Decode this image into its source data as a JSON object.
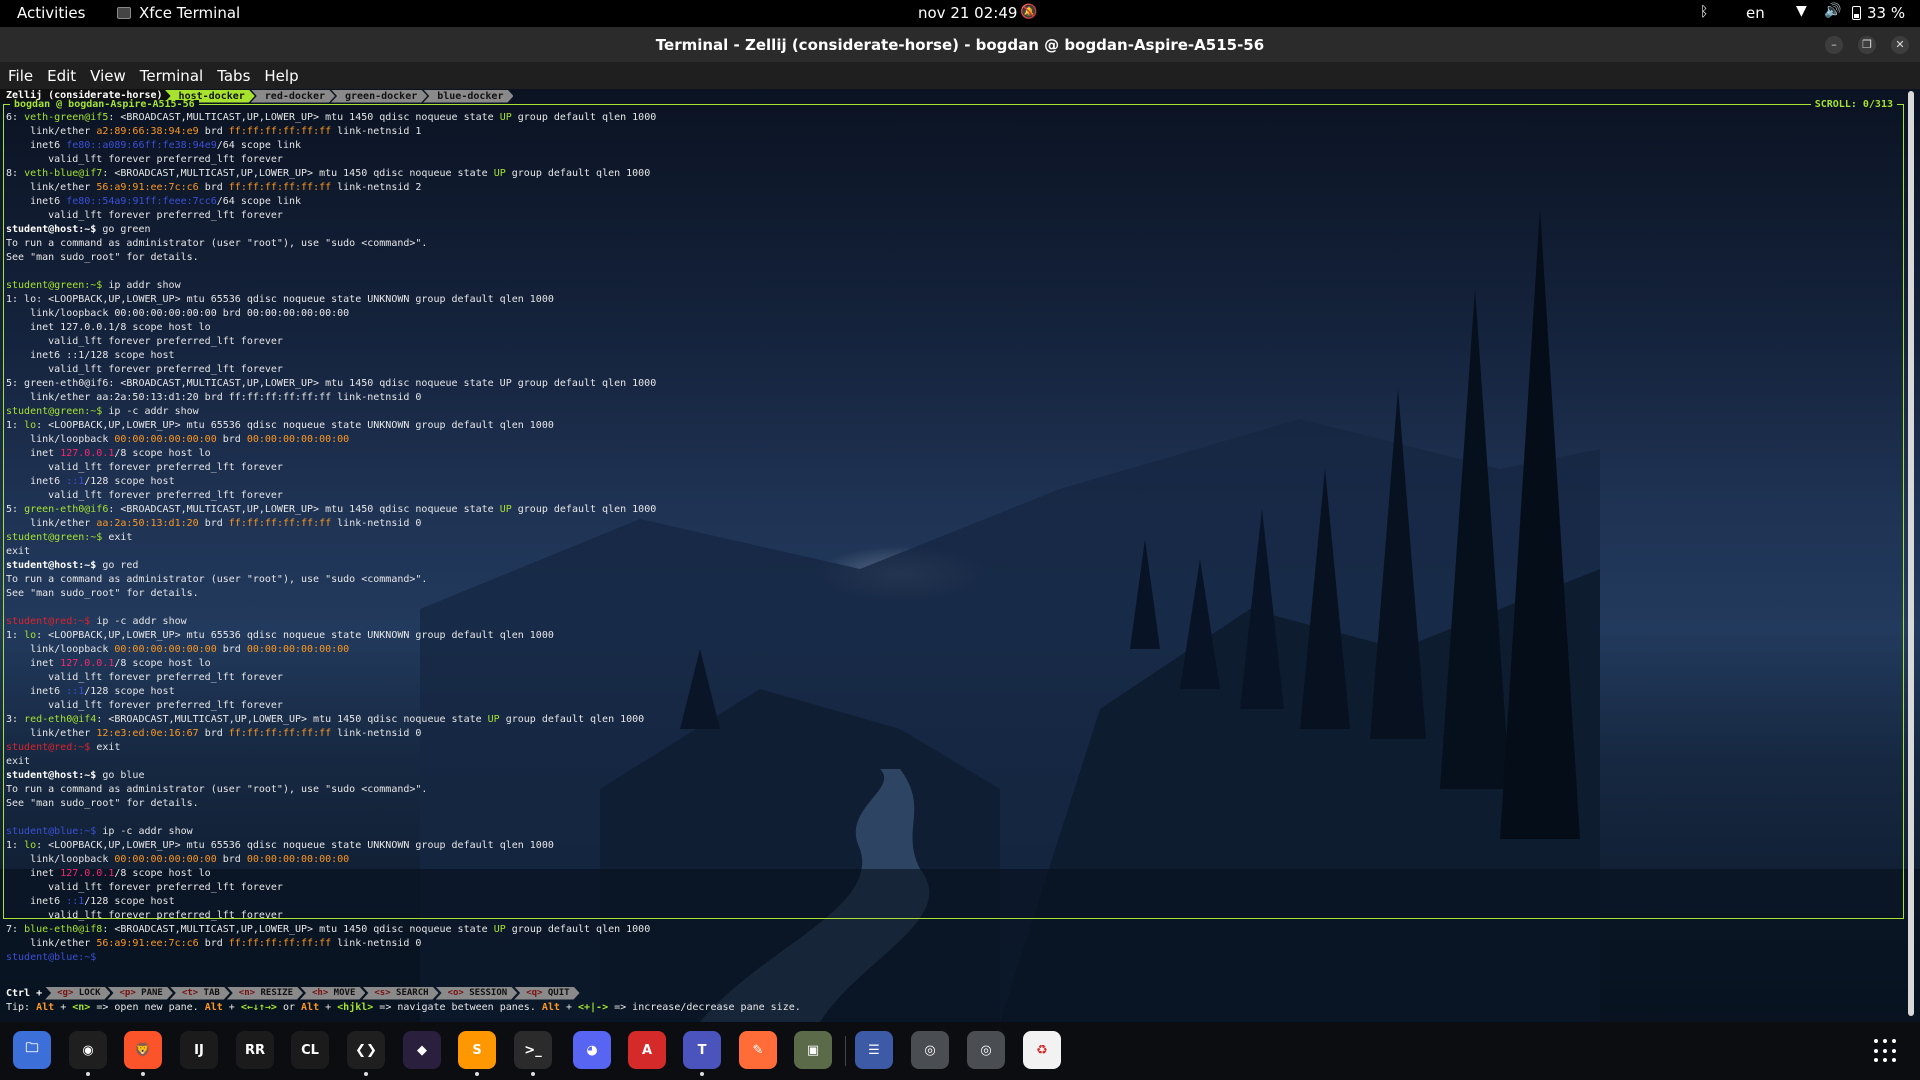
{
  "topbar": {
    "activities": "Activities",
    "app_name": "Xfce Terminal",
    "clock": "nov 21  02:49",
    "language": "en",
    "battery": "33 %"
  },
  "window": {
    "title": "Terminal - Zellij (considerate-horse) - bogdan @ bogdan-Aspire-A515-56",
    "min": "–",
    "max": "❐",
    "close": "✕"
  },
  "menu": [
    "File",
    "Edit",
    "View",
    "Terminal",
    "Tabs",
    "Help"
  ],
  "zellij": {
    "session": "Zellij (considerate-horse)",
    "tabs": [
      "host-docker",
      "red-docker",
      "green-docker",
      "blue-docker"
    ],
    "pane_title": "bogdan @ bogdan-Aspire-A515-56",
    "scroll": "SCROLL:  0/313",
    "ctrl": "Ctrl +",
    "keys": [
      {
        "k": "<g>",
        "label": "LOCK"
      },
      {
        "k": "<p>",
        "label": "PANE"
      },
      {
        "k": "<t>",
        "label": "TAB"
      },
      {
        "k": "<n>",
        "label": "RESIZE"
      },
      {
        "k": "<h>",
        "label": "MOVE"
      },
      {
        "k": "<s>",
        "label": "SEARCH"
      },
      {
        "k": "<o>",
        "label": "SESSION"
      },
      {
        "k": "<q>",
        "label": "QUIT"
      }
    ],
    "tip": [
      {
        "t": "Tip: ",
        "c": ""
      },
      {
        "t": "Alt",
        "c": "tk"
      },
      {
        "t": " + ",
        "c": ""
      },
      {
        "t": "<n>",
        "c": "tg"
      },
      {
        "t": " => open new pane. ",
        "c": ""
      },
      {
        "t": "Alt",
        "c": "tk"
      },
      {
        "t": " + ",
        "c": ""
      },
      {
        "t": "<←↓↑→>",
        "c": "tg"
      },
      {
        "t": " or ",
        "c": ""
      },
      {
        "t": "Alt",
        "c": "tk"
      },
      {
        "t": " + ",
        "c": ""
      },
      {
        "t": "<hjkl>",
        "c": "tg"
      },
      {
        "t": " => navigate between panes. ",
        "c": ""
      },
      {
        "t": "Alt",
        "c": "tk"
      },
      {
        "t": " + ",
        "c": ""
      },
      {
        "t": "<+|->",
        "c": "tg"
      },
      {
        "t": " => increase/decrease pane size.",
        "c": ""
      }
    ]
  },
  "terminal_lines": [
    [
      {
        "t": "6: ",
        "c": ""
      },
      {
        "t": "veth-green@if5",
        "c": "green"
      },
      {
        "t": ": <BROADCAST,MULTICAST,UP,LOWER_UP> mtu 1450 qdisc noqueue state ",
        "c": ""
      },
      {
        "t": "UP",
        "c": "green"
      },
      {
        "t": " group default qlen 1000",
        "c": ""
      }
    ],
    [
      {
        "t": "    link/ether ",
        "c": ""
      },
      {
        "t": "a2:89:66:38:94:e9",
        "c": "orange"
      },
      {
        "t": " brd ",
        "c": ""
      },
      {
        "t": "ff:ff:ff:ff:ff:ff",
        "c": "orange"
      },
      {
        "t": " link-netnsid 1",
        "c": ""
      }
    ],
    [
      {
        "t": "    inet6 ",
        "c": ""
      },
      {
        "t": "fe80::a089:66ff:fe38:94e9",
        "c": "blue"
      },
      {
        "t": "/64 scope link",
        "c": ""
      }
    ],
    [
      {
        "t": "       valid_lft forever preferred_lft forever",
        "c": ""
      }
    ],
    [
      {
        "t": "8: ",
        "c": ""
      },
      {
        "t": "veth-blue@if7",
        "c": "green"
      },
      {
        "t": ": <BROADCAST,MULTICAST,UP,LOWER_UP> mtu 1450 qdisc noqueue state ",
        "c": ""
      },
      {
        "t": "UP",
        "c": "green"
      },
      {
        "t": " group default qlen 1000",
        "c": ""
      }
    ],
    [
      {
        "t": "    link/ether ",
        "c": ""
      },
      {
        "t": "56:a9:91:ee:7c:c6",
        "c": "orange"
      },
      {
        "t": " brd ",
        "c": ""
      },
      {
        "t": "ff:ff:ff:ff:ff:ff",
        "c": "orange"
      },
      {
        "t": " link-netnsid 2",
        "c": ""
      }
    ],
    [
      {
        "t": "    inet6 ",
        "c": ""
      },
      {
        "t": "fe80::54a9:91ff:feee:7cc6",
        "c": "blue"
      },
      {
        "t": "/64 scope link",
        "c": ""
      }
    ],
    [
      {
        "t": "       valid_lft forever preferred_lft forever",
        "c": ""
      }
    ],
    [
      {
        "t": "student@host:~$",
        "c": "bold"
      },
      {
        "t": " go green",
        "c": ""
      }
    ],
    [
      {
        "t": "To run a command as administrator (user \"root\"), use \"sudo <command>\".",
        "c": ""
      }
    ],
    [
      {
        "t": "See \"man sudo_root\" for details.",
        "c": ""
      }
    ],
    [
      {
        "t": "",
        "c": ""
      }
    ],
    [
      {
        "t": "student@green:~$",
        "c": "green"
      },
      {
        "t": " ip addr show",
        "c": ""
      }
    ],
    [
      {
        "t": "1: lo: <LOOPBACK,UP,LOWER_UP> mtu 65536 qdisc noqueue state UNKNOWN group default qlen 1000",
        "c": ""
      }
    ],
    [
      {
        "t": "    link/loopback 00:00:00:00:00:00 brd 00:00:00:00:00:00",
        "c": ""
      }
    ],
    [
      {
        "t": "    inet 127.0.0.1/8 scope host lo",
        "c": ""
      }
    ],
    [
      {
        "t": "       valid_lft forever preferred_lft forever",
        "c": ""
      }
    ],
    [
      {
        "t": "    inet6 ::1/128 scope host",
        "c": ""
      }
    ],
    [
      {
        "t": "       valid_lft forever preferred_lft forever",
        "c": ""
      }
    ],
    [
      {
        "t": "5: green-eth0@if6: <BROADCAST,MULTICAST,UP,LOWER_UP> mtu 1450 qdisc noqueue state UP group default qlen 1000",
        "c": ""
      }
    ],
    [
      {
        "t": "    link/ether aa:2a:50:13:d1:20 brd ff:ff:ff:ff:ff:ff link-netnsid 0",
        "c": ""
      }
    ],
    [
      {
        "t": "student@green:~$",
        "c": "green"
      },
      {
        "t": " ip -c addr show",
        "c": ""
      }
    ],
    [
      {
        "t": "1: ",
        "c": ""
      },
      {
        "t": "lo",
        "c": "green"
      },
      {
        "t": ": <LOOPBACK,UP,LOWER_UP> mtu 65536 qdisc noqueue state UNKNOWN group default qlen 1000",
        "c": ""
      }
    ],
    [
      {
        "t": "    link/loopback ",
        "c": ""
      },
      {
        "t": "00:00:00:00:00:00",
        "c": "orange"
      },
      {
        "t": " brd ",
        "c": ""
      },
      {
        "t": "00:00:00:00:00:00",
        "c": "orange"
      }
    ],
    [
      {
        "t": "    inet ",
        "c": ""
      },
      {
        "t": "127.0.0.1",
        "c": "pink"
      },
      {
        "t": "/8 scope host lo",
        "c": ""
      }
    ],
    [
      {
        "t": "       valid_lft forever preferred_lft forever",
        "c": ""
      }
    ],
    [
      {
        "t": "    inet6 ",
        "c": ""
      },
      {
        "t": "::1",
        "c": "blue"
      },
      {
        "t": "/128 scope host",
        "c": ""
      }
    ],
    [
      {
        "t": "       valid_lft forever preferred_lft forever",
        "c": ""
      }
    ],
    [
      {
        "t": "5: ",
        "c": ""
      },
      {
        "t": "green-eth0@if6",
        "c": "green"
      },
      {
        "t": ": <BROADCAST,MULTICAST,UP,LOWER_UP> mtu 1450 qdisc noqueue state ",
        "c": ""
      },
      {
        "t": "UP",
        "c": "green"
      },
      {
        "t": " group default qlen 1000",
        "c": ""
      }
    ],
    [
      {
        "t": "    link/ether ",
        "c": ""
      },
      {
        "t": "aa:2a:50:13:d1:20",
        "c": "orange"
      },
      {
        "t": " brd ",
        "c": ""
      },
      {
        "t": "ff:ff:ff:ff:ff:ff",
        "c": "orange"
      },
      {
        "t": " link-netnsid 0",
        "c": ""
      }
    ],
    [
      {
        "t": "student@green:~$",
        "c": "green"
      },
      {
        "t": " exit",
        "c": ""
      }
    ],
    [
      {
        "t": "exit",
        "c": ""
      }
    ],
    [
      {
        "t": "student@host:~$",
        "c": "bold"
      },
      {
        "t": " go red",
        "c": ""
      }
    ],
    [
      {
        "t": "To run a command as administrator (user \"root\"), use \"sudo <command>\".",
        "c": ""
      }
    ],
    [
      {
        "t": "See \"man sudo_root\" for details.",
        "c": ""
      }
    ],
    [
      {
        "t": "",
        "c": ""
      }
    ],
    [
      {
        "t": "student@red:~$",
        "c": "red"
      },
      {
        "t": " ip -c addr show",
        "c": ""
      }
    ],
    [
      {
        "t": "1: ",
        "c": ""
      },
      {
        "t": "lo",
        "c": "green"
      },
      {
        "t": ": <LOOPBACK,UP,LOWER_UP> mtu 65536 qdisc noqueue state UNKNOWN group default qlen 1000",
        "c": ""
      }
    ],
    [
      {
        "t": "    link/loopback ",
        "c": ""
      },
      {
        "t": "00:00:00:00:00:00",
        "c": "orange"
      },
      {
        "t": " brd ",
        "c": ""
      },
      {
        "t": "00:00:00:00:00:00",
        "c": "orange"
      }
    ],
    [
      {
        "t": "    inet ",
        "c": ""
      },
      {
        "t": "127.0.0.1",
        "c": "pink"
      },
      {
        "t": "/8 scope host lo",
        "c": ""
      }
    ],
    [
      {
        "t": "       valid_lft forever preferred_lft forever",
        "c": ""
      }
    ],
    [
      {
        "t": "    inet6 ",
        "c": ""
      },
      {
        "t": "::1",
        "c": "blue"
      },
      {
        "t": "/128 scope host",
        "c": ""
      }
    ],
    [
      {
        "t": "       valid_lft forever preferred_lft forever",
        "c": ""
      }
    ],
    [
      {
        "t": "3: ",
        "c": ""
      },
      {
        "t": "red-eth0@if4",
        "c": "green"
      },
      {
        "t": ": <BROADCAST,MULTICAST,UP,LOWER_UP> mtu 1450 qdisc noqueue state ",
        "c": ""
      },
      {
        "t": "UP",
        "c": "green"
      },
      {
        "t": " group default qlen 1000",
        "c": ""
      }
    ],
    [
      {
        "t": "    link/ether ",
        "c": ""
      },
      {
        "t": "12:e3:ed:0e:16:67",
        "c": "orange"
      },
      {
        "t": " brd ",
        "c": ""
      },
      {
        "t": "ff:ff:ff:ff:ff:ff",
        "c": "orange"
      },
      {
        "t": " link-netnsid 0",
        "c": ""
      }
    ],
    [
      {
        "t": "student@red:~$",
        "c": "red"
      },
      {
        "t": " exit",
        "c": ""
      }
    ],
    [
      {
        "t": "exit",
        "c": ""
      }
    ],
    [
      {
        "t": "student@host:~$",
        "c": "bold"
      },
      {
        "t": " go blue",
        "c": ""
      }
    ],
    [
      {
        "t": "To run a command as administrator (user \"root\"), use \"sudo <command>\".",
        "c": ""
      }
    ],
    [
      {
        "t": "See \"man sudo_root\" for details.",
        "c": ""
      }
    ],
    [
      {
        "t": "",
        "c": ""
      }
    ],
    [
      {
        "t": "student@blue:~$",
        "c": "blue"
      },
      {
        "t": " ip -c addr show",
        "c": ""
      }
    ],
    [
      {
        "t": "1: ",
        "c": ""
      },
      {
        "t": "lo",
        "c": "green"
      },
      {
        "t": ": <LOOPBACK,UP,LOWER_UP> mtu 65536 qdisc noqueue state UNKNOWN group default qlen 1000",
        "c": ""
      }
    ],
    [
      {
        "t": "    link/loopback ",
        "c": ""
      },
      {
        "t": "00:00:00:00:00:00",
        "c": "orange"
      },
      {
        "t": " brd ",
        "c": ""
      },
      {
        "t": "00:00:00:00:00:00",
        "c": "orange"
      }
    ],
    [
      {
        "t": "    inet ",
        "c": ""
      },
      {
        "t": "127.0.0.1",
        "c": "pink"
      },
      {
        "t": "/8 scope host lo",
        "c": ""
      }
    ],
    [
      {
        "t": "       valid_lft forever preferred_lft forever",
        "c": ""
      }
    ],
    [
      {
        "t": "    inet6 ",
        "c": ""
      },
      {
        "t": "::1",
        "c": "blue"
      },
      {
        "t": "/128 scope host",
        "c": ""
      }
    ],
    [
      {
        "t": "       valid_lft forever preferred_lft forever",
        "c": ""
      }
    ],
    [
      {
        "t": "7: ",
        "c": ""
      },
      {
        "t": "blue-eth0@if8",
        "c": "green"
      },
      {
        "t": ": <BROADCAST,MULTICAST,UP,LOWER_UP> mtu 1450 qdisc noqueue state ",
        "c": ""
      },
      {
        "t": "UP",
        "c": "green"
      },
      {
        "t": " group default qlen 1000",
        "c": ""
      }
    ],
    [
      {
        "t": "    link/ether ",
        "c": ""
      },
      {
        "t": "56:a9:91:ee:7c:c6",
        "c": "orange"
      },
      {
        "t": " brd ",
        "c": ""
      },
      {
        "t": "ff:ff:ff:ff:ff:ff",
        "c": "orange"
      },
      {
        "t": " link-netnsid 0",
        "c": ""
      }
    ],
    [
      {
        "t": "student@blue:~$",
        "c": "blue"
      },
      {
        "t": " ",
        "c": ""
      }
    ]
  ],
  "dock": [
    {
      "name": "files-icon",
      "glyph": "🗀",
      "bg": "#3d6fd9",
      "running": false
    },
    {
      "name": "chrome-icon",
      "glyph": "◉",
      "bg": "#1f1f1f",
      "running": true
    },
    {
      "name": "brave-icon",
      "glyph": "🦁",
      "bg": "#fb542b",
      "running": true
    },
    {
      "name": "intellij-icon",
      "glyph": "IJ",
      "bg": "#1b1b1b",
      "running": false
    },
    {
      "name": "rider-icon",
      "glyph": "RR",
      "bg": "#1b1b1b",
      "running": false
    },
    {
      "name": "clion-icon",
      "glyph": "CL",
      "bg": "#1b1b1b",
      "running": false
    },
    {
      "name": "vscode-icon",
      "glyph": "❮❯",
      "bg": "#1f1f1f",
      "running": true
    },
    {
      "name": "obsidian-icon",
      "glyph": "◆",
      "bg": "#2a1f3d",
      "running": false
    },
    {
      "name": "sublime-icon",
      "glyph": "S",
      "bg": "#ff9800",
      "running": true
    },
    {
      "name": "terminal-icon",
      "glyph": ">_",
      "bg": "#2b2b2b",
      "running": true
    },
    {
      "name": "discord-icon",
      "glyph": "◕",
      "bg": "#5865f2",
      "running": false
    },
    {
      "name": "pdf-icon",
      "glyph": "A",
      "bg": "#d42a2a",
      "running": false
    },
    {
      "name": "teams-icon",
      "glyph": "T",
      "bg": "#4b53bc",
      "running": true
    },
    {
      "name": "postman-icon",
      "glyph": "✎",
      "bg": "#ff6c37",
      "running": false
    },
    {
      "name": "archive-icon",
      "glyph": "▣",
      "bg": "#5b6b4a",
      "running": false
    },
    {
      "name": "tasks-icon",
      "glyph": "☰",
      "bg": "#3c5aa6",
      "running": false
    },
    {
      "name": "disk-icon-1",
      "glyph": "◎",
      "bg": "#4a4d52",
      "running": false
    },
    {
      "name": "disk-icon-2",
      "glyph": "◎",
      "bg": "#4a4d52",
      "running": false
    },
    {
      "name": "trash-icon",
      "glyph": "♻",
      "bg": "#f2f2f2",
      "running": false
    }
  ]
}
